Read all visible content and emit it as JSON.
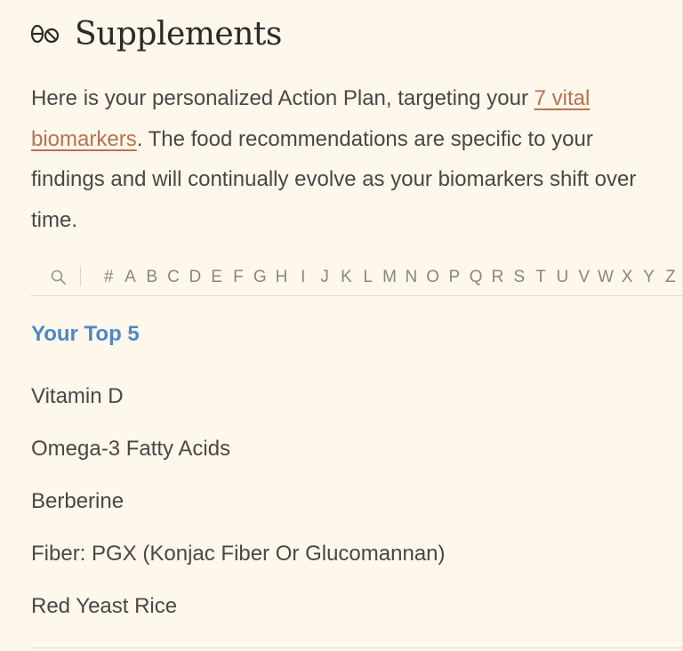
{
  "header": {
    "icon": "supplements-pills-icon",
    "title": "Supplements"
  },
  "intro": {
    "text_before": "Here is your personalized Action Plan, targeting your ",
    "link_text": "7 vital biomarkers",
    "text_after": ". The food recommendations are specific to your findings and will continually evolve as your biomarkers shift over time."
  },
  "index": {
    "search_icon": "search-icon",
    "letters": [
      "#",
      "A",
      "B",
      "C",
      "D",
      "E",
      "F",
      "G",
      "H",
      "I",
      "J",
      "K",
      "L",
      "M",
      "N",
      "O",
      "P",
      "Q",
      "R",
      "S",
      "T",
      "U",
      "V",
      "W",
      "X",
      "Y",
      "Z"
    ]
  },
  "top5": {
    "title": "Your Top 5",
    "items": [
      "Vitamin D",
      "Omega-3 Fatty Acids",
      "Berberine",
      "Fiber: PGX (Konjac Fiber Or Glucomannan)",
      "Red Yeast Rice"
    ]
  },
  "colors": {
    "background": "#fdf7ec",
    "link": "#b8714f",
    "section_title": "#4f86c6",
    "body_text": "#4a4744"
  }
}
